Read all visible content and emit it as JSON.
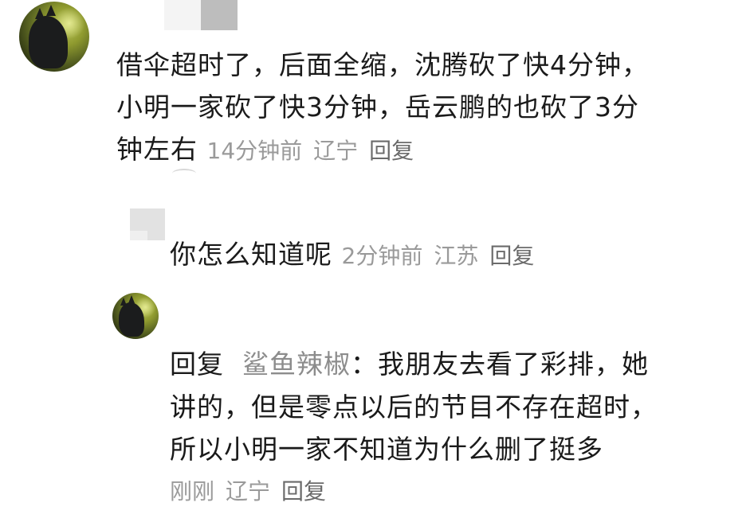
{
  "comment1": {
    "lines": [
      "借伞超时了，后面全缩，沈腾砍了快4分钟，",
      "小明一家砍了快3分钟，岳云鹏的也砍了3分",
      "钟左右"
    ],
    "time": "14分钟前",
    "location": "辽宁",
    "reply_label": "回复"
  },
  "comment2": {
    "text": "你怎么知道呢",
    "time": "2分钟前",
    "location": "江苏",
    "reply_label": "回复"
  },
  "comment3": {
    "reply_prefix": "回复",
    "mention": "鲨鱼辣椒",
    "colon": "：",
    "lines": [
      "我朋友去看了彩排，她",
      "讲的，但是零点以后的节目不存在超时，",
      "所以小明一家不知道为什么删了挺多"
    ],
    "time": "刚刚",
    "location": "辽宁",
    "reply_label": "回复"
  }
}
